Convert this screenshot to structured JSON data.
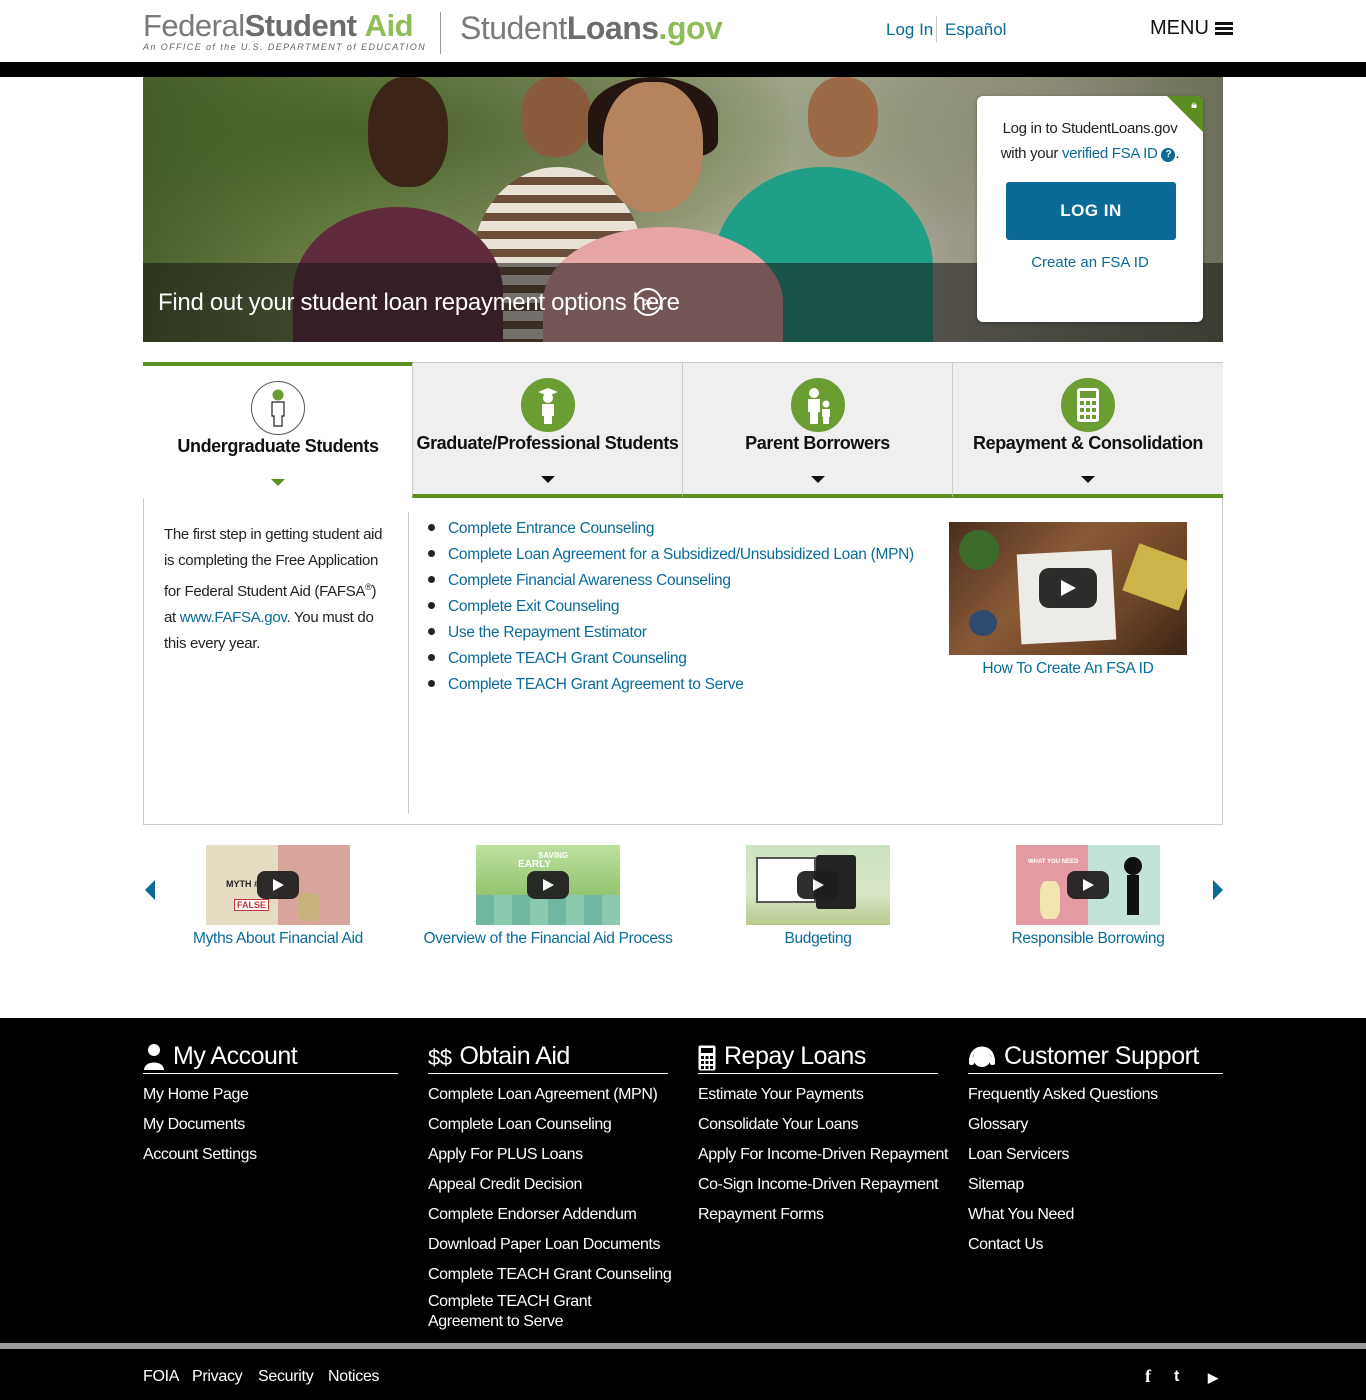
{
  "header": {
    "fsa_logo": {
      "part1": "Federal",
      "part2": "Student",
      "part3": "Aid",
      "tagline": "An OFFICE of the U.S. DEPARTMENT of EDUCATION"
    },
    "sl_logo": {
      "part1": "Student",
      "part2": "Loans",
      "part3": ".gov"
    },
    "login_link": "Log In",
    "espanol_link": "Español",
    "menu_label": "MENU"
  },
  "hero": {
    "caption": "Find out your student loan repayment options here",
    "caption_icon": "double-chevron-right-icon"
  },
  "login_card": {
    "line1": "Log in to StudentLoans.gov",
    "line2_prefix": "with your ",
    "line2_link": "verified FSA ID",
    "help_icon": "?",
    "button_label": "LOG IN",
    "create_link": "Create an FSA ID"
  },
  "tabs": [
    {
      "label": "Undergraduate Students",
      "icon": "student-icon",
      "active": true
    },
    {
      "label": "Graduate/Professional Students",
      "icon": "graduate-icon",
      "active": false
    },
    {
      "label": "Parent Borrowers",
      "icon": "parent-child-icon",
      "active": false
    },
    {
      "label": "Repayment & Consolidation",
      "icon": "calculator-icon",
      "active": false
    }
  ],
  "undergrad": {
    "desc_part1": "The first step in getting student aid is completing the Free Application for Federal Student Aid (FAFSA",
    "desc_reg": "®",
    "desc_part2": ") at ",
    "desc_link": "www.FAFSA.gov",
    "desc_part3": ". You must do this every year.",
    "links": [
      "Complete Entrance Counseling",
      "Complete Loan Agreement for a Subsidized/Unsubsidized Loan (MPN)",
      "Complete Financial Awareness Counseling",
      "Complete Exit Counseling",
      "Use the Repayment Estimator",
      "Complete TEACH Grant Counseling",
      "Complete TEACH Grant Agreement to Serve"
    ],
    "video_caption": "How To Create An FSA ID"
  },
  "videos": [
    {
      "caption": "Myths About Financial Aid",
      "thumb_text": "MYTH #",
      "thumb_text2": "FALSE"
    },
    {
      "caption": "Overview of the Financial Aid Process",
      "thumb_text": "EARLY",
      "thumb_text2": "SAVING"
    },
    {
      "caption": "Budgeting",
      "thumb_text": "",
      "thumb_text2": ""
    },
    {
      "caption": "Responsible Borrowing",
      "thumb_text": "WHAT YOU NEED",
      "thumb_text2": ""
    }
  ],
  "footer": {
    "columns": [
      {
        "title": "My Account",
        "icon": "person-icon",
        "links": [
          "My Home Page",
          "My Documents",
          "Account Settings"
        ]
      },
      {
        "title": "Obtain Aid",
        "icon": "dollar-icon",
        "icon_text": "$$",
        "links": [
          "Complete Loan Agreement (MPN)",
          "Complete Loan Counseling",
          "Apply For PLUS Loans",
          "Appeal Credit Decision",
          "Complete Endorser Addendum",
          "Download Paper Loan Documents",
          "Complete TEACH Grant Counseling",
          "Complete TEACH Grant Agreement to Serve"
        ]
      },
      {
        "title": "Repay Loans",
        "icon": "calculator-icon",
        "links": [
          "Estimate Your Payments",
          "Consolidate Your Loans",
          "Apply For Income-Driven Repayment",
          "Co-Sign Income-Driven Repayment",
          "Repayment Forms"
        ]
      },
      {
        "title": "Customer Support",
        "icon": "headset-icon",
        "links": [
          "Frequently Asked Questions",
          "Glossary",
          "Loan Servicers",
          "Sitemap",
          "What You Need",
          "Contact Us"
        ]
      }
    ],
    "bottom_links": [
      "FOIA",
      "Privacy",
      "Security",
      "Notices"
    ],
    "social": [
      {
        "name": "facebook-icon",
        "glyph": "f"
      },
      {
        "name": "twitter-icon",
        "glyph": "t"
      },
      {
        "name": "youtube-icon",
        "glyph": "▶"
      }
    ]
  },
  "colors": {
    "accent_green": "#5b8f22",
    "link_blue": "#0a6b99",
    "button_blue": "#0a6b99",
    "footer_bg": "#000000"
  }
}
